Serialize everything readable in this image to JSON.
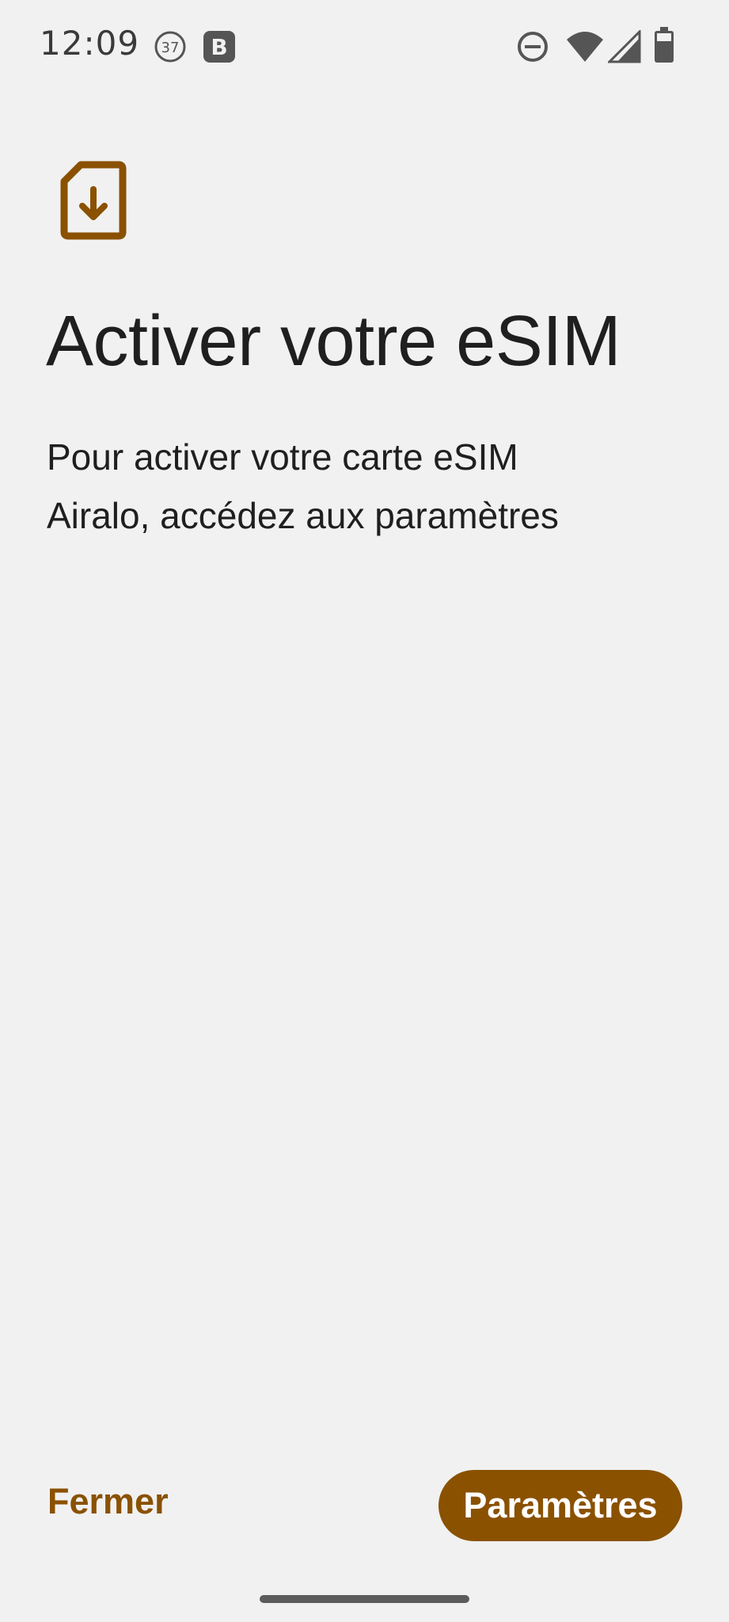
{
  "status_bar": {
    "time": "12:09",
    "notification_badge": "37",
    "app_badge": "B",
    "icons": [
      "do-not-disturb-icon",
      "wifi-icon",
      "cell-signal-icon",
      "battery-icon"
    ]
  },
  "main": {
    "icon": "sim-card-download-icon",
    "title": "Activer votre eSIM",
    "description_line1": "Pour activer votre carte eSIM",
    "description_line2": "Airalo, accédez aux paramètres"
  },
  "footer": {
    "close_label": "Fermer",
    "settings_label": "Paramètres"
  },
  "colors": {
    "background": "#f1f1f1",
    "accent": "#8a5100",
    "text": "#1f1f1f"
  }
}
